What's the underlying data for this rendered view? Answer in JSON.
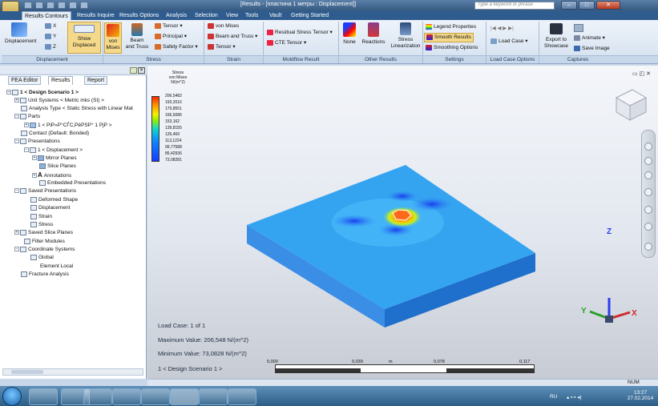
{
  "window": {
    "title": "[Results - [пластина 1 метры : Displacement]]",
    "search_placeholder": "Type a keyword or phrase"
  },
  "menu_tabs": [
    "Results Contours",
    "Results Inquire",
    "Results Options",
    "Analysis",
    "Selection",
    "View",
    "Tools",
    "Vault",
    "Getting Started"
  ],
  "ribbon": {
    "displacement_group": {
      "displacement": "Displacement",
      "x": "X",
      "y": "Y",
      "z": "Z",
      "show_displaced_1": "Show",
      "show_displaced_2": "Displaced",
      "label": "Displacement"
    },
    "stress_group": {
      "von_mises_1": "von",
      "von_mises_2": "Mises",
      "beam_1": "Beam",
      "beam_2": "and Truss",
      "tensor": "Tensor",
      "principal": "Principal",
      "safety": "Safety Factor",
      "label": "Stress"
    },
    "strain_group": {
      "von_mises": "von Mises",
      "beam": "Beam and Truss",
      "tensor": "Tensor",
      "label": "Strain"
    },
    "moldflow_group": {
      "residual": "Residual Stress Tensor",
      "cte": "CTE Tensor",
      "label": "Moldflow Result"
    },
    "other_group": {
      "none": "None",
      "reactions": "Reactions",
      "stress_lin_1": "Stress",
      "stress_lin_2": "Linearization",
      "label": "Other Results"
    },
    "settings_group": {
      "legend": "Legend Properties",
      "smooth": "Smooth Results",
      "smoothing": "Smoothing Options",
      "label": "Settings"
    },
    "loadcase_group": {
      "load_case": "Load Case",
      "label": "Load Case Options"
    },
    "captures_group": {
      "export_1": "Export to",
      "export_2": "Showcase",
      "animate": "Animate",
      "save_image": "Save Image",
      "label": "Captures"
    }
  },
  "left_panel": {
    "tabs": [
      "FEA Editor",
      "Results",
      "Report"
    ],
    "tree": [
      "1 < Design Scenario 1 >",
      "Unit Systems < Metric mks (SI) >",
      "Analysis Type < Static Stress with Linear Mat",
      "Parts",
      "1 < PiP»P°CЃC‚PёPSP° 1 PјP >",
      "Contact (Default: Bonded)",
      "Presentations",
      "1 < Displacement >",
      "Mirror Planes",
      "Slice Planes",
      "Annotations",
      "Embedded Presentations",
      "Saved Presentations",
      "Deformed Shape",
      "Displacement",
      "Strain",
      "Stress",
      "Saved Slice Planes",
      "Filter Modules",
      "Coordinate Systems",
      "Global",
      "Element Local",
      "Fracture Analysis"
    ]
  },
  "legend": {
    "title_1": "Stress",
    "title_2": "von Mises",
    "unit": "N/(m^2)",
    "values": [
      "206,5482",
      "193,2016",
      "179,8551",
      "166,5086",
      "153,162",
      "139,8155",
      "126,469",
      "113,1224",
      "99,77588",
      "86,42936",
      "73,08281"
    ]
  },
  "info": {
    "load_case": "Load Case:   1 of 1",
    "max_value": "Maximum Value: 206,548 N/(m^2)",
    "min_value": "Minimum Value: 73,0828 N/(m^2)",
    "scenario": "1 < Design Scenario 1 >"
  },
  "scale": {
    "ticks": [
      "0,000",
      "0,039",
      "m",
      "0,078",
      "0,117"
    ]
  },
  "triad": {
    "x": "X",
    "y": "Y",
    "z": "Z"
  },
  "status": {
    "num": "NUM"
  },
  "taskbar": {
    "lang": "RU",
    "time": "13:27",
    "date": "27.02.2014"
  },
  "colors": {
    "accent": "#2f5c8f",
    "plate_blue": "#2f9fe8"
  }
}
